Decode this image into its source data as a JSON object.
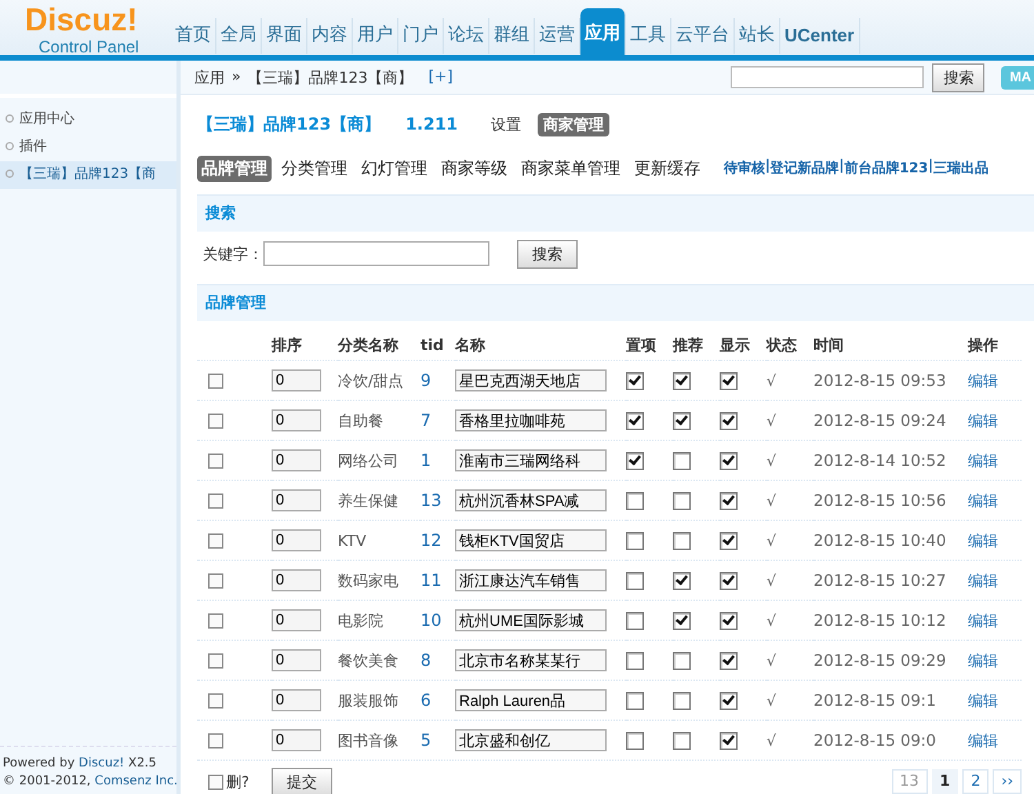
{
  "header": {
    "logo": {
      "brand": "Discuz!",
      "subtitle": "Control Panel"
    },
    "nav": [
      {
        "label": "首页",
        "selected": false
      },
      {
        "label": "全局",
        "selected": false
      },
      {
        "label": "界面",
        "selected": false
      },
      {
        "label": "内容",
        "selected": false
      },
      {
        "label": "用户",
        "selected": false
      },
      {
        "label": "门户",
        "selected": false
      },
      {
        "label": "论坛",
        "selected": false
      },
      {
        "label": "群组",
        "selected": false
      },
      {
        "label": "运营",
        "selected": false
      },
      {
        "label": "应用",
        "selected": true
      },
      {
        "label": "工具",
        "selected": false
      },
      {
        "label": "云平台",
        "selected": false
      },
      {
        "label": "站长",
        "selected": false
      },
      {
        "label": "UCenter",
        "selected": false
      }
    ],
    "breadcrumb": {
      "items": [
        "应用",
        "【三瑞】品牌123【商】"
      ],
      "separator": "»",
      "add": "[+]"
    },
    "search_button": "搜索",
    "corner_button": "MA"
  },
  "sidebar": {
    "items": [
      {
        "label": "应用中心",
        "selected": false
      },
      {
        "label": "插件",
        "selected": false
      },
      {
        "label": "【三瑞】品牌123【商",
        "selected": true
      }
    ],
    "footer": {
      "powered": "Powered by",
      "powered_link": "Discuz!",
      "version": "X2.5",
      "copyright": "© 2001-2012,",
      "company_link": "Comsenz Inc."
    }
  },
  "plugin": {
    "title": "【三瑞】品牌123【商】",
    "version": "1.211",
    "mode_tabs": [
      {
        "label": "设置",
        "selected": false
      },
      {
        "label": "商家管理",
        "selected": true
      }
    ],
    "tabs": [
      {
        "label": "品牌管理",
        "selected": true
      },
      {
        "label": "分类管理",
        "selected": false
      },
      {
        "label": "幻灯管理",
        "selected": false
      },
      {
        "label": "商家等级",
        "selected": false
      },
      {
        "label": "商家菜单管理",
        "selected": false
      },
      {
        "label": "更新缓存",
        "selected": false
      }
    ],
    "links": [
      "待审核",
      "登记新品牌",
      "前台品牌123",
      "三瑞出品"
    ],
    "link_separator": "|"
  },
  "search": {
    "title": "搜索",
    "label": "关键字：",
    "button": "搜索"
  },
  "table": {
    "title": "品牌管理",
    "columns": [
      "排序",
      "分类名称",
      "tid",
      "名称",
      "置项",
      "推荐",
      "显示",
      "状态",
      "时间",
      "操作"
    ],
    "rows": [
      {
        "checked": false,
        "order": "0",
        "category": "冷饮/甜点",
        "tid": "9",
        "name": "星巴克西湖天地店",
        "top": true,
        "recommend": true,
        "show": true,
        "status": "√",
        "time": "2012-8-15 09:53",
        "action": "编辑"
      },
      {
        "checked": false,
        "order": "0",
        "category": "自助餐",
        "tid": "7",
        "name": "香格里拉咖啡苑",
        "top": true,
        "recommend": true,
        "show": true,
        "status": "√",
        "time": "2012-8-15 09:24",
        "action": "编辑"
      },
      {
        "checked": false,
        "order": "0",
        "category": "网络公司",
        "tid": "1",
        "name": "淮南市三瑞网络科",
        "top": true,
        "recommend": false,
        "show": true,
        "status": "√",
        "time": "2012-8-14 10:52",
        "action": "编辑"
      },
      {
        "checked": false,
        "order": "0",
        "category": "养生保健",
        "tid": "13",
        "name": "杭州沉香林SPA减",
        "top": false,
        "recommend": false,
        "show": true,
        "status": "√",
        "time": "2012-8-15 10:56",
        "action": "编辑"
      },
      {
        "checked": false,
        "order": "0",
        "category": "KTV",
        "tid": "12",
        "name": "钱柜KTV国贸店",
        "top": false,
        "recommend": false,
        "show": true,
        "status": "√",
        "time": "2012-8-15 10:40",
        "action": "编辑"
      },
      {
        "checked": false,
        "order": "0",
        "category": "数码家电",
        "tid": "11",
        "name": "浙江康达汽车销售",
        "top": false,
        "recommend": true,
        "show": true,
        "status": "√",
        "time": "2012-8-15 10:27",
        "action": "编辑"
      },
      {
        "checked": false,
        "order": "0",
        "category": "电影院",
        "tid": "10",
        "name": "杭州UME国际影城",
        "top": false,
        "recommend": true,
        "show": true,
        "status": "√",
        "time": "2012-8-15 10:12",
        "action": "编辑"
      },
      {
        "checked": false,
        "order": "0",
        "category": "餐饮美食",
        "tid": "8",
        "name": "北京市名称某某行",
        "top": false,
        "recommend": false,
        "show": true,
        "status": "√",
        "time": "2012-8-15 09:29",
        "action": "编辑"
      },
      {
        "checked": false,
        "order": "0",
        "category": "服装服饰",
        "tid": "6",
        "name": "Ralph Lauren品",
        "top": false,
        "recommend": false,
        "show": true,
        "status": "√",
        "time": "2012-8-15 09:1",
        "action": "编辑"
      },
      {
        "checked": false,
        "order": "0",
        "category": "图书音像",
        "tid": "5",
        "name": "北京盛和创亿",
        "top": false,
        "recommend": false,
        "show": true,
        "status": "√",
        "time": "2012-8-15 09:0",
        "action": "编辑"
      }
    ],
    "delete": {
      "label": "删?",
      "checked": false
    },
    "submit": "提交",
    "pagination": [
      {
        "label": "13",
        "kind": "count"
      },
      {
        "label": "1",
        "kind": "page",
        "selected": true
      },
      {
        "label": "2",
        "kind": "page",
        "selected": false
      },
      {
        "label": "››",
        "kind": "next",
        "selected": false
      }
    ]
  }
}
